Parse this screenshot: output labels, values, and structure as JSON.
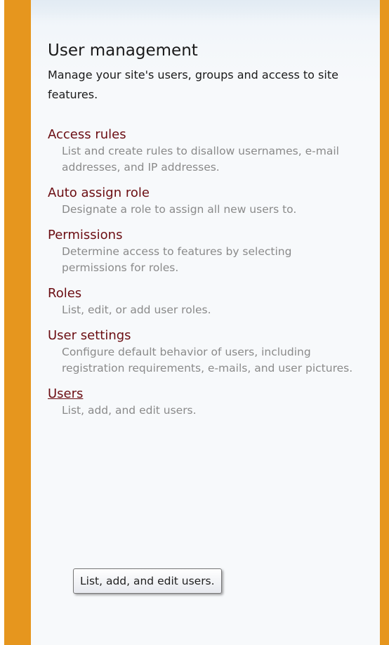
{
  "section": {
    "title": "User management",
    "description": "Manage your site's users, groups and access to site features."
  },
  "items": [
    {
      "label": "Access rules",
      "description": "List and create rules to disallow usernames, e-mail addresses, and IP addresses."
    },
    {
      "label": "Auto assign role",
      "description": "Designate a role to assign all new users to."
    },
    {
      "label": "Permissions",
      "description": "Determine access to features by selecting permissions for roles."
    },
    {
      "label": "Roles",
      "description": "List, edit, or add user roles."
    },
    {
      "label": "User settings",
      "description": "Configure default behavior of users, including registration requirements, e-mails, and user pictures."
    },
    {
      "label": "Users",
      "description": "List, add, and edit users."
    }
  ],
  "tooltip": {
    "text": "List, add, and edit users."
  },
  "colors": {
    "accent_bar": "#e6961e",
    "link": "#6b0d12",
    "description": "#8a8a8a",
    "panel_background": "#f7f9fb"
  }
}
